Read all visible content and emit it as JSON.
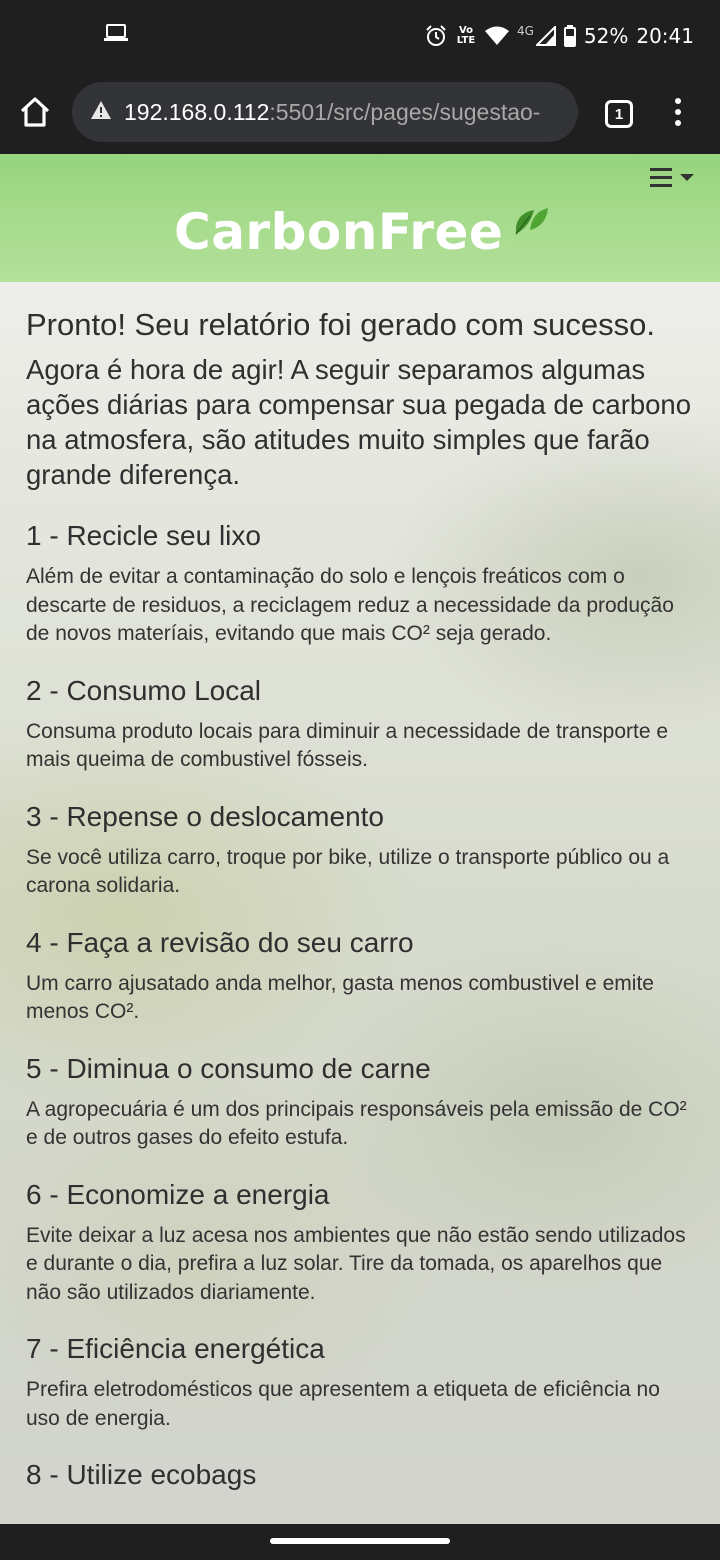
{
  "status_bar": {
    "battery_percent": "52%",
    "time": "20:41",
    "network": "4G",
    "volte": "Vo LTE",
    "icons": [
      "laptop-icon",
      "alarm-icon",
      "volte-icon",
      "wifi-icon",
      "signal-icon",
      "battery-icon"
    ]
  },
  "browser": {
    "url_host": "192.168.0.112",
    "url_path": ":5501/src/pages/sugestao-",
    "tab_count": "1",
    "icons": [
      "home-icon",
      "warning-icon",
      "tabs-icon",
      "more-menu-icon"
    ]
  },
  "header": {
    "logo_text": "CarbonFree",
    "header_color": "#a5da8b",
    "icons": [
      "hamburger-menu-icon",
      "leaf-icon"
    ]
  },
  "content": {
    "title": "Pronto! Seu relatório foi gerado com sucesso.",
    "intro": "Agora é hora de agir! A seguir separamos algumas ações diárias para compensar sua pegada de carbono na atmosfera, são atitudes muito simples que farão grande diferença.",
    "items": [
      {
        "heading": "1 - Recicle seu lixo",
        "text": "Além de evitar a contaminação do solo e lençois freáticos com o descarte de residuos, a reciclagem reduz a necessidade da produção de novos materíais, evitando que mais CO² seja gerado."
      },
      {
        "heading": "2 - Consumo Local",
        "text": "Consuma produto locais para diminuir a necessidade de transporte e mais queima de combustivel fósseis."
      },
      {
        "heading": "3 - Repense o deslocamento",
        "text": "Se você utiliza carro, troque por bike, utilize o transporte público ou a carona solidaria."
      },
      {
        "heading": "4 - Faça a revisão do seu carro",
        "text": "Um carro ajusatado anda melhor, gasta menos combustivel e emite menos CO²."
      },
      {
        "heading": "5 - Diminua o consumo de carne",
        "text": "A agropecuária é um dos principais responsáveis pela emissão de CO² e de outros gases do efeito estufa."
      },
      {
        "heading": "6 - Economize a energia",
        "text": "Evite deixar a luz acesa nos ambientes que não estão sendo utilizados e durante o dia, prefira a luz solar. Tire da tomada, os aparelhos que não são utilizados diariamente."
      },
      {
        "heading": "7 - Eficiência energética",
        "text": "Prefira eletrodomésticos que apresentem a etiqueta de eficiência no uso de energia."
      },
      {
        "heading": "8 - Utilize ecobags",
        "text": ""
      }
    ]
  }
}
